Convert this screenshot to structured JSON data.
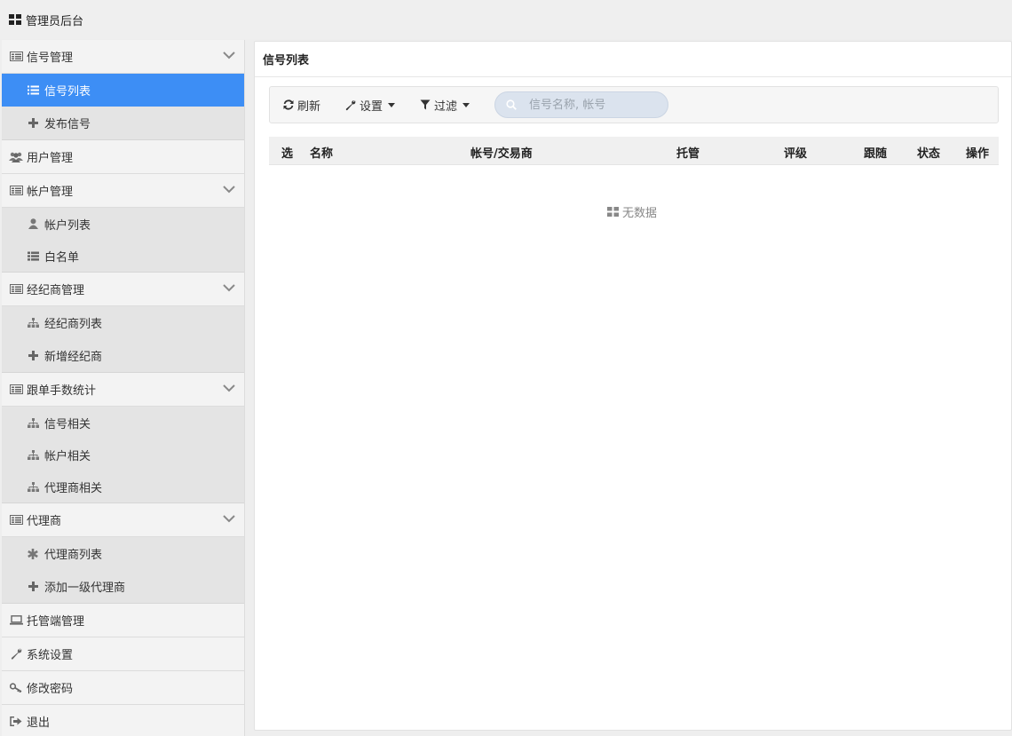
{
  "app": {
    "title": "管理员后台",
    "brand_icon": "grid-icon"
  },
  "sidebar": {
    "groups": [
      {
        "label": "信号管理",
        "icon": "list-alt-icon",
        "expandable": true,
        "items": [
          {
            "label": "信号列表",
            "icon": "list-icon",
            "active": true
          },
          {
            "label": "发布信号",
            "icon": "plus-icon"
          }
        ]
      },
      {
        "label": "用户管理",
        "icon": "users-icon",
        "expandable": false
      },
      {
        "label": "帐户管理",
        "icon": "list-alt-icon",
        "expandable": true,
        "items": [
          {
            "label": "帐户列表",
            "icon": "user-icon"
          },
          {
            "label": "白名单",
            "icon": "list-icon"
          }
        ]
      },
      {
        "label": "经纪商管理",
        "icon": "list-alt-icon",
        "expandable": true,
        "items": [
          {
            "label": "经纪商列表",
            "icon": "sitemap-icon"
          },
          {
            "label": "新增经纪商",
            "icon": "plus-icon"
          }
        ]
      },
      {
        "label": "跟单手数统计",
        "icon": "list-alt-icon",
        "expandable": true,
        "items": [
          {
            "label": "信号相关",
            "icon": "sitemap-icon"
          },
          {
            "label": "帐户相关",
            "icon": "sitemap-icon"
          },
          {
            "label": "代理商相关",
            "icon": "sitemap-icon"
          }
        ]
      },
      {
        "label": "代理商",
        "icon": "list-alt-icon",
        "expandable": true,
        "items": [
          {
            "label": "代理商列表",
            "icon": "asterisk-icon"
          },
          {
            "label": "添加一级代理商",
            "icon": "plus-icon"
          }
        ]
      },
      {
        "label": "托管端管理",
        "icon": "laptop-icon",
        "expandable": false
      },
      {
        "label": "系统设置",
        "icon": "wrench-icon",
        "expandable": false
      },
      {
        "label": "修改密码",
        "icon": "key-icon",
        "expandable": false
      },
      {
        "label": "退出",
        "icon": "sign-out-icon",
        "expandable": false
      }
    ]
  },
  "main": {
    "title": "信号列表",
    "toolbar": {
      "refresh_label": "刷新",
      "settings_label": "设置",
      "filter_label": "过滤",
      "search_placeholder": "信号名称, 帐号",
      "search_value": ""
    },
    "table": {
      "columns": [
        "选",
        "名称",
        "帐号/交易商",
        "托管",
        "评级",
        "跟随",
        "状态",
        "操作"
      ],
      "rows": [],
      "empty_text": "无数据"
    }
  },
  "colors": {
    "accent": "#3d8ef5",
    "page_bg": "#eeeeee",
    "sub_bg": "#e4e4e4"
  }
}
